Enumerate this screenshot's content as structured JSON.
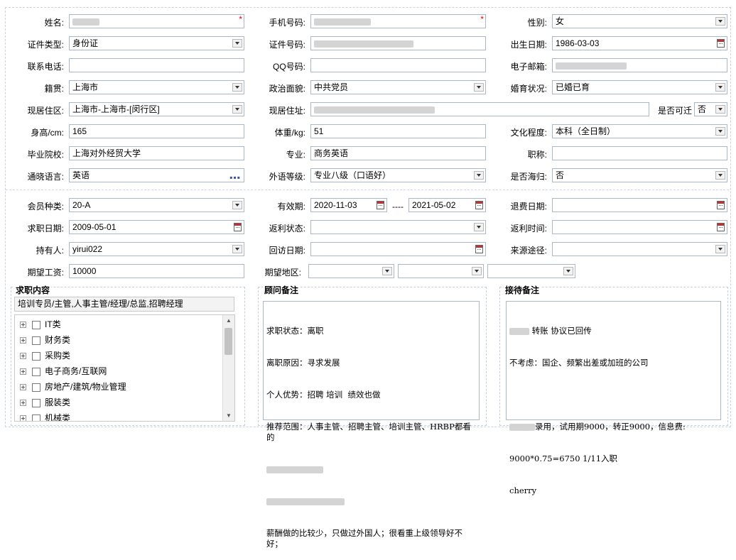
{
  "form": {
    "name": {
      "label": "姓名:",
      "value": ""
    },
    "mobile": {
      "label": "手机号码:",
      "value": ""
    },
    "gender": {
      "label": "性别:",
      "value": "女"
    },
    "id_type": {
      "label": "证件类型:",
      "value": "身份证"
    },
    "id_no": {
      "label": "证件号码:",
      "value": ""
    },
    "birth": {
      "label": "出生日期:",
      "value": "1986-03-03"
    },
    "phone": {
      "label": "联系电话:",
      "value": ""
    },
    "qq": {
      "label": "QQ号码:",
      "value": ""
    },
    "email": {
      "label": "电子邮箱:",
      "value": ""
    },
    "native": {
      "label": "籍贯:",
      "value": "上海市"
    },
    "politics": {
      "label": "政治面貌:",
      "value": "中共党员"
    },
    "marital": {
      "label": "婚育状况:",
      "value": "已婚已育"
    },
    "residence_area": {
      "label": "现居住区:",
      "value": "上海市-上海市-[闵行区]"
    },
    "address": {
      "label": "现居住址:",
      "value": ""
    },
    "relocate": {
      "label": "是否可迁",
      "value": "否"
    },
    "height": {
      "label": "身高/cm:",
      "value": "165"
    },
    "weight": {
      "label": "体重/kg:",
      "value": "51"
    },
    "education": {
      "label": "文化程度:",
      "value": "本科（全日制）"
    },
    "school": {
      "label": "毕业院校:",
      "value": "上海对外经贸大学"
    },
    "major": {
      "label": "专业:",
      "value": "商务英语"
    },
    "title": {
      "label": "职称:",
      "value": ""
    },
    "language": {
      "label": "通晓语言:",
      "value": "英语"
    },
    "lang_level": {
      "label": "外语等级:",
      "value": "专业八级（口语好）"
    },
    "returnee": {
      "label": "是否海归:",
      "value": "否"
    }
  },
  "member": {
    "type": {
      "label": "会员种类:",
      "value": "20-A"
    },
    "validity": {
      "label": "有效期:",
      "from": "2020-11-03",
      "sep": "----",
      "to": "2021-05-02"
    },
    "refund_date": {
      "label": "退费日期:",
      "value": ""
    },
    "job_date": {
      "label": "求职日期:",
      "value": "2009-05-01"
    },
    "rebate_status": {
      "label": "返利状态:",
      "value": ""
    },
    "rebate_time": {
      "label": "返利时间:",
      "value": ""
    },
    "holder": {
      "label": "持有人:",
      "value": "yirui022"
    },
    "revisit_date": {
      "label": "回访日期:",
      "value": ""
    },
    "source": {
      "label": "来源途径:",
      "value": ""
    },
    "salary": {
      "label": "期望工资:",
      "value": "10000"
    },
    "region": {
      "label": "期望地区:"
    }
  },
  "job_panel": {
    "title": "求职内容",
    "selected": "培训专员/主管,人事主管/经理/总监,招聘经理",
    "categories": [
      "IT类",
      "财务类",
      "采购类",
      "电子商务/互联网",
      "房地产/建筑/物业管理",
      "服装类",
      "机械类"
    ]
  },
  "advisor_panel": {
    "title": "顾问备注",
    "lines": [
      "求职状态：离职",
      "离职原因：寻求发展",
      "个人优势：招聘 培训  绩效也做",
      "推荐范围：人事主管、招聘主管、培训主管、HRBP都看的",
      "薪酬做的比较少，只做过外国人；很看重上级领导好不好；"
    ]
  },
  "reception_panel": {
    "title": "接待备注",
    "lines": [
      "转账 协议已回传",
      "不考虑：国企、频繁出差或加班的公司",
      "录用，试用期9000，转正9000，信息费:",
      "9000*0.75=6750 1/11入职",
      "cherry"
    ]
  }
}
